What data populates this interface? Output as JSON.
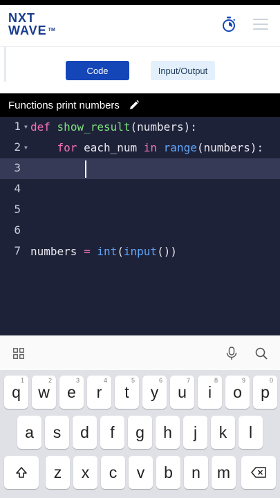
{
  "app": {
    "logo_line1": "NXT",
    "logo_line2": "WAVE",
    "logo_tm": "TM"
  },
  "tabs": {
    "code_label": "Code",
    "io_label": "Input/Output"
  },
  "editor": {
    "title": "Functions print numbers",
    "active_line": 3,
    "lines": [
      {
        "num": "1",
        "text": "def show_result(numbers):"
      },
      {
        "num": "2",
        "text": "    for each_num in range(numbers):"
      },
      {
        "num": "3",
        "text": ""
      },
      {
        "num": "4",
        "text": ""
      },
      {
        "num": "5",
        "text": ""
      },
      {
        "num": "6",
        "text": ""
      },
      {
        "num": "7",
        "text": "numbers = int(input())"
      }
    ]
  },
  "keyboard": {
    "row1": [
      {
        "k": "q",
        "h": "1"
      },
      {
        "k": "w",
        "h": "2"
      },
      {
        "k": "e",
        "h": "3"
      },
      {
        "k": "r",
        "h": "4"
      },
      {
        "k": "t",
        "h": "5"
      },
      {
        "k": "y",
        "h": "6"
      },
      {
        "k": "u",
        "h": "7"
      },
      {
        "k": "i",
        "h": "8"
      },
      {
        "k": "o",
        "h": "9"
      },
      {
        "k": "p",
        "h": "0"
      }
    ],
    "row2": [
      "a",
      "s",
      "d",
      "f",
      "g",
      "h",
      "j",
      "k",
      "l"
    ],
    "row3": [
      "z",
      "x",
      "c",
      "v",
      "b",
      "n",
      "m"
    ]
  },
  "colors": {
    "brand": "#183b8c",
    "primary_button": "#1546b8",
    "editor_bg": "#1e2238",
    "keyword": "#f472b6",
    "function_name": "#7fe07f",
    "builtin": "#60a5fa"
  }
}
